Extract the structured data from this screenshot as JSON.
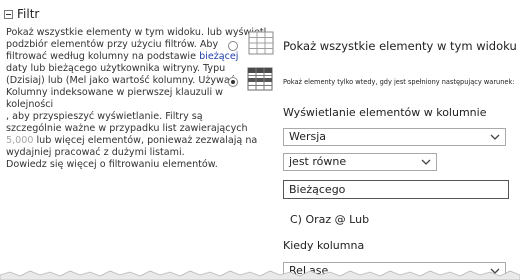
{
  "section": {
    "title": "Filtr"
  },
  "help": {
    "line1": "Pokaż wszystkie elementy w tym widoku. lub wyświetl",
    "line2": "podzbiór elementów przy użyciu filtrów. Aby",
    "line3a": "filtrować według kolumny na podstawie ",
    "line3b": "bieżącej",
    "line4": "daty lub bieżącego użytkownika witryny. Typu",
    "line5": "(Dzisiaj) lub (Mel jako wartość kolumny. Używać",
    "line6": "Kolumny indeksowane w pierwszej klauzuli w kolejności",
    "line7": ", aby przyspieszyć wyświetlanie. Filtry są",
    "line8": "szczególnie ważne w przypadku list zawierających",
    "line9a": "5,000",
    "line9b": " lub więcej elementów, ponieważ zezwalają na",
    "line10": "wydajniej pracować z dużymi listami.",
    "line11": "Dowiedz się więcej o filtrowaniu elementów."
  },
  "options": {
    "show_all": "Pokaż wszystkie elementy w tym widoku",
    "show_filtered": "Pokaż elementy tylko wtedy, gdy jest spełniony następujący warunek:"
  },
  "filter": {
    "heading": "Wyświetlanie elementów w kolumnie",
    "column1": "Wersja",
    "operator1": "jest równe",
    "value1": "Bieżącego",
    "and_or": "C) Oraz @ Lub",
    "when_label": "Kiedy kolumna",
    "column2": "ReLase"
  }
}
